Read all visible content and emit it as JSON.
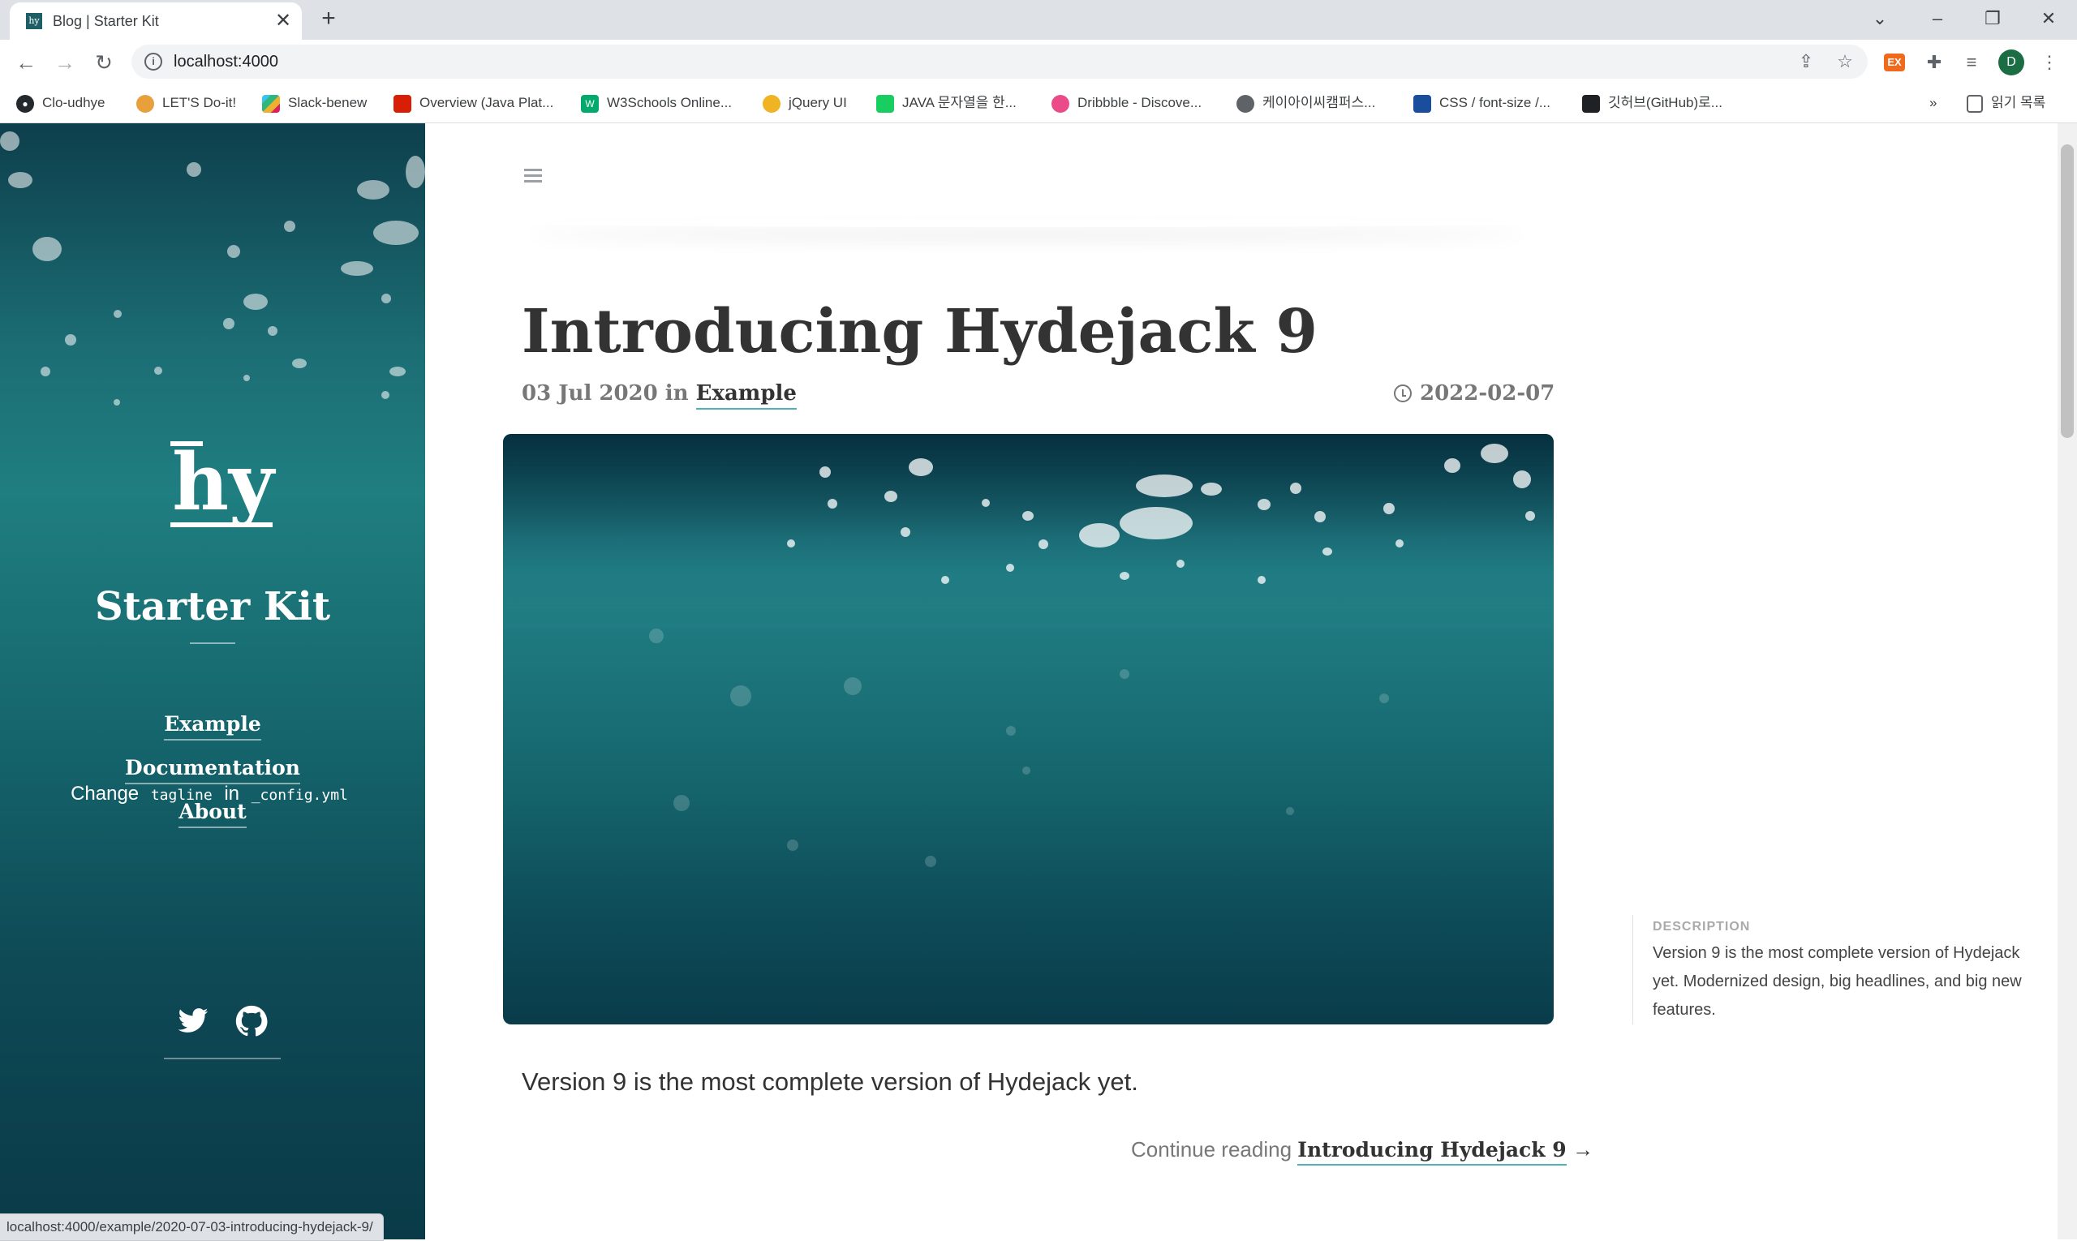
{
  "browser": {
    "tab_title": "Blog | Starter Kit",
    "favicon_text": "hy",
    "url": "localhost:4000",
    "profile_initial": "D",
    "ext_badge": "EX",
    "bookmarks": [
      {
        "label": "Clo-udhye",
        "icon": "github-icon",
        "color": "#24292e"
      },
      {
        "label": "LET'S Do-it!",
        "icon": "bread-icon",
        "color": "#e8a03c"
      },
      {
        "label": "Slack-benew",
        "icon": "slack-icon",
        "color": "#4a154b"
      },
      {
        "label": "Overview (Java Plat...",
        "icon": "oracle-icon",
        "color": "#d81e05"
      },
      {
        "label": "W3Schools Online...",
        "icon": "w3schools-icon",
        "color": "#04aa6d"
      },
      {
        "label": "jQuery UI",
        "icon": "jquery-icon",
        "color": "#f0b323"
      },
      {
        "label": "JAVA 문자열을 한...",
        "icon": "blog-icon",
        "color": "#19ce60"
      },
      {
        "label": "Dribbble - Discove...",
        "icon": "dribbble-icon",
        "color": "#ea4c89"
      },
      {
        "label": "케이아이씨캠퍼스...",
        "icon": "globe-icon",
        "color": "#5f6368"
      },
      {
        "label": "CSS / font-size /...",
        "icon": "chart-icon",
        "color": "#1a4d9c"
      },
      {
        "label": "깃허브(GitHub)로...",
        "icon": "doc-icon",
        "color": "#202124"
      }
    ],
    "bookmarks_overflow": "»",
    "reading_list": "읽기 목록",
    "status_url": "localhost:4000/example/2020-07-03-introducing-hydejack-9/"
  },
  "sidebar": {
    "logo": "hy",
    "site_title": "Starter Kit",
    "tagline_pre": "Change",
    "tagline_code1": "tagline",
    "tagline_mid": "in",
    "tagline_code2": "_config.yml",
    "links": [
      "Example",
      "Documentation",
      "About"
    ]
  },
  "post": {
    "title": "Introducing Hydejack 9",
    "date": "03 Jul 2020",
    "in_word": "in",
    "category": "Example",
    "updated": "2022-02-07",
    "excerpt": "Version 9 is the most complete version of Hydejack yet.",
    "continue_prefix": "Continue reading",
    "continue_title": "Introducing Hydejack 9",
    "continue_arrow": "→"
  },
  "description": {
    "heading": "DESCRIPTION",
    "text": "Version 9 is the most complete version of Hydejack yet. Modernized design, big headlines, and big new features."
  },
  "colors": {
    "accent": "#4fb1ba",
    "sidebar_teal": "#1c6d74"
  }
}
